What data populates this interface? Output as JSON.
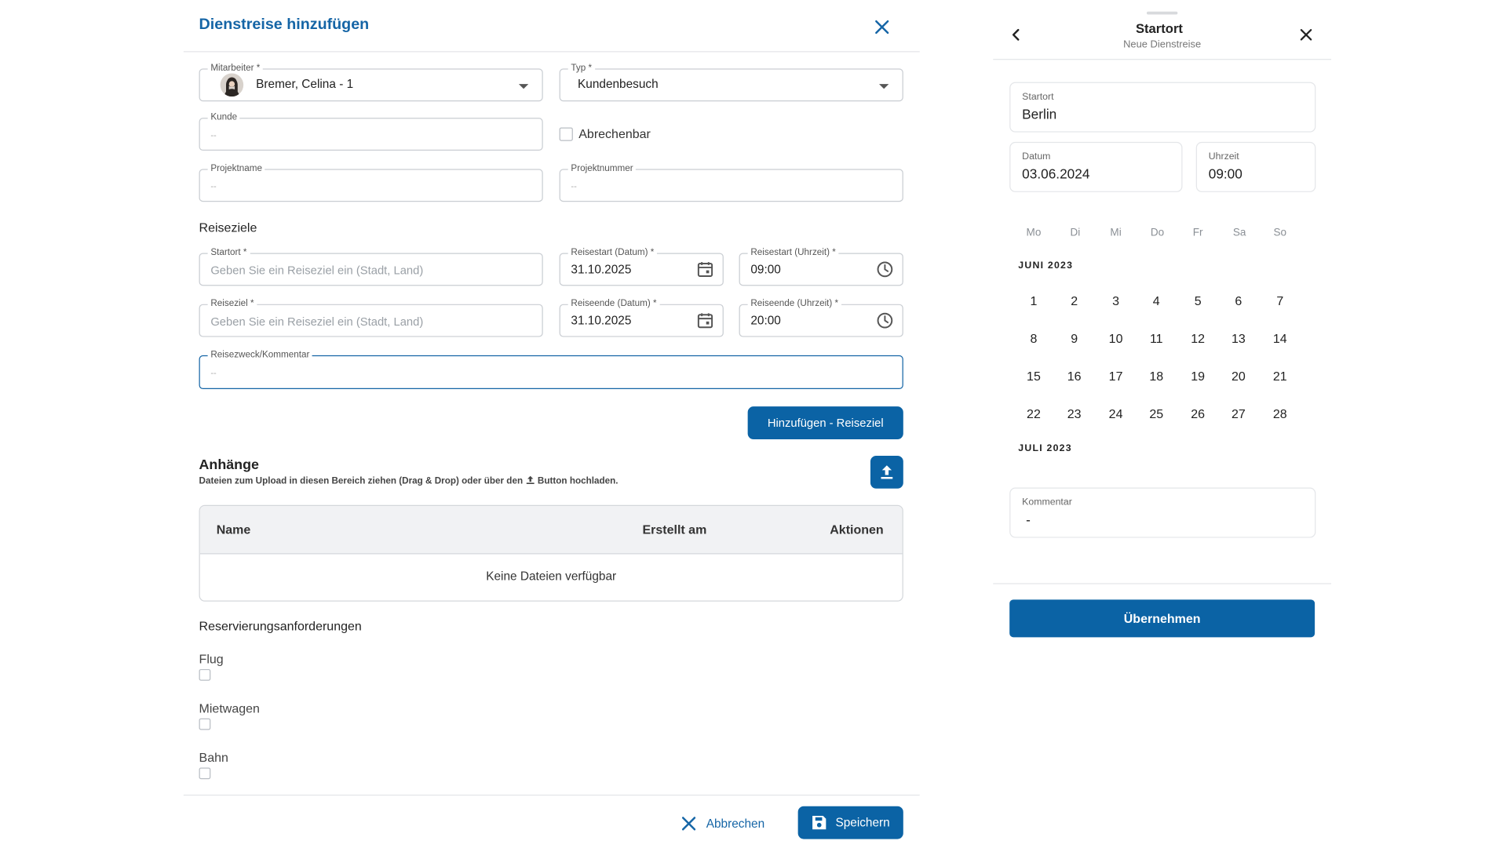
{
  "dialog": {
    "title": "Dienstreise hinzufügen",
    "fields": {
      "mitarbeiter": {
        "label": "Mitarbeiter  *",
        "value": "Bremer, Celina - 1"
      },
      "typ": {
        "label": "Typ *",
        "value": "Kundenbesuch"
      },
      "kunde": {
        "label": "Kunde",
        "placeholder": "--"
      },
      "abrechenbar": {
        "label": "Abrechenbar",
        "checked": false
      },
      "projektname": {
        "label": "Projektname",
        "placeholder": "--"
      },
      "projektnummer": {
        "label": "Projektnummer",
        "placeholder": "--"
      }
    },
    "reiseziele": {
      "heading": "Reiseziele",
      "startort": {
        "label": "Startort *",
        "placeholder": "Geben Sie ein Reiseziel ein (Stadt, Land)"
      },
      "reisestart_datum": {
        "label": "Reisestart (Datum) *",
        "value": "31.10.2025"
      },
      "reisestart_uhrzeit": {
        "label": "Reisestart (Uhrzeit) *",
        "value": "09:00"
      },
      "reiseziel": {
        "label": "Reiseziel *",
        "placeholder": "Geben Sie ein Reiseziel ein (Stadt, Land)"
      },
      "reiseende_datum": {
        "label": "Reiseende (Datum) *",
        "value": "31.10.2025"
      },
      "reiseende_uhrzeit": {
        "label": "Reiseende (Uhrzeit) *",
        "value": "20:00"
      },
      "kommentar": {
        "label": "Reisezweck/Kommentar",
        "placeholder": "--"
      },
      "add_button": "Hinzufügen - Reiseziel"
    },
    "anhaenge": {
      "heading": "Anhänge",
      "hint_before": "Dateien zum Upload in diesen Bereich ziehen (Drag & Drop) oder über den",
      "hint_after": "Button hochladen.",
      "columns": [
        "Name",
        "Erstellt am",
        "Aktionen"
      ],
      "empty": "Keine Dateien verfügbar"
    },
    "reservierung": {
      "heading": "Reservierungsanforderungen",
      "options": [
        {
          "label": "Flug",
          "checked": false
        },
        {
          "label": "Mietwagen",
          "checked": false
        },
        {
          "label": "Bahn",
          "checked": false
        }
      ]
    },
    "footer": {
      "cancel": "Abbrechen",
      "save": "Speichern"
    }
  },
  "panel": {
    "title": "Startort",
    "subtitle": "Neue Dienstreise",
    "startort": {
      "label": "Startort",
      "value": "Berlin"
    },
    "datum": {
      "label": "Datum",
      "value": "03.06.2024"
    },
    "uhrzeit": {
      "label": "Uhrzeit",
      "value": "09:00"
    },
    "weekdays": [
      "Mo",
      "Di",
      "Mi",
      "Do",
      "Fr",
      "Sa",
      "So"
    ],
    "month1": "JUNI 2023",
    "days": [
      [
        "1",
        "2",
        "3",
        "4",
        "5",
        "6",
        "7"
      ],
      [
        "8",
        "9",
        "10",
        "11",
        "12",
        "13",
        "14"
      ],
      [
        "15",
        "16",
        "17",
        "18",
        "19",
        "20",
        "21"
      ],
      [
        "22",
        "23",
        "24",
        "25",
        "26",
        "27",
        "28"
      ]
    ],
    "month2": "JULI 2023",
    "kommentar": {
      "label": "Kommentar",
      "value": "-"
    },
    "apply": "Übernehmen"
  },
  "colors": {
    "accent": "#0b63a5",
    "title": "#1565a6",
    "focus": "#1565a6"
  }
}
